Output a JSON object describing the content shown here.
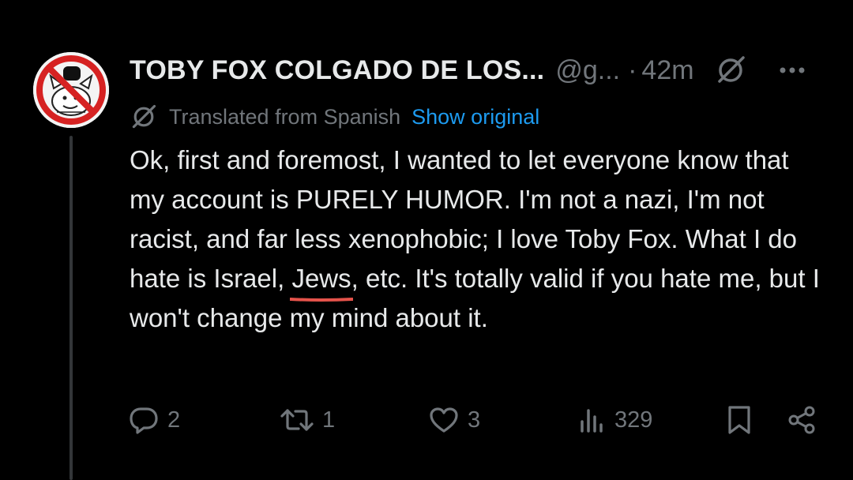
{
  "post": {
    "author": {
      "display_name": "TOBY FOX COLGADO DE LOS...",
      "handle": "@g...",
      "avatar_icon": "crossed-out-cartoon-avatar"
    },
    "separator": "·",
    "timestamp": "42m",
    "translation": {
      "label": "Translated from Spanish",
      "show_original": "Show original"
    },
    "text_before": "Ok, first and foremost, I wanted to let everyone know that my account is PURELY HUMOR. I'm not a nazi, I'm not racist, and far less xenophobic; I love Toby Fox. What I do hate is Israel, ",
    "text_highlight": "Jews",
    "text_after": ", etc. It's totally valid if you hate me, but I won't change my mind about it.",
    "actions": {
      "replies": "2",
      "reposts": "1",
      "likes": "3",
      "views": "329"
    }
  },
  "colors": {
    "background": "#000000",
    "text": "#e7e9ea",
    "secondary": "#71767b",
    "link": "#1d9bf0",
    "annotation": "#e5534b",
    "thread_line": "#333639"
  },
  "icons": {
    "grok": "grok-icon",
    "more": "more-icon",
    "reply": "reply-icon",
    "repost": "repost-icon",
    "like": "like-icon",
    "views": "views-icon",
    "bookmark": "bookmark-icon",
    "share": "share-icon"
  }
}
